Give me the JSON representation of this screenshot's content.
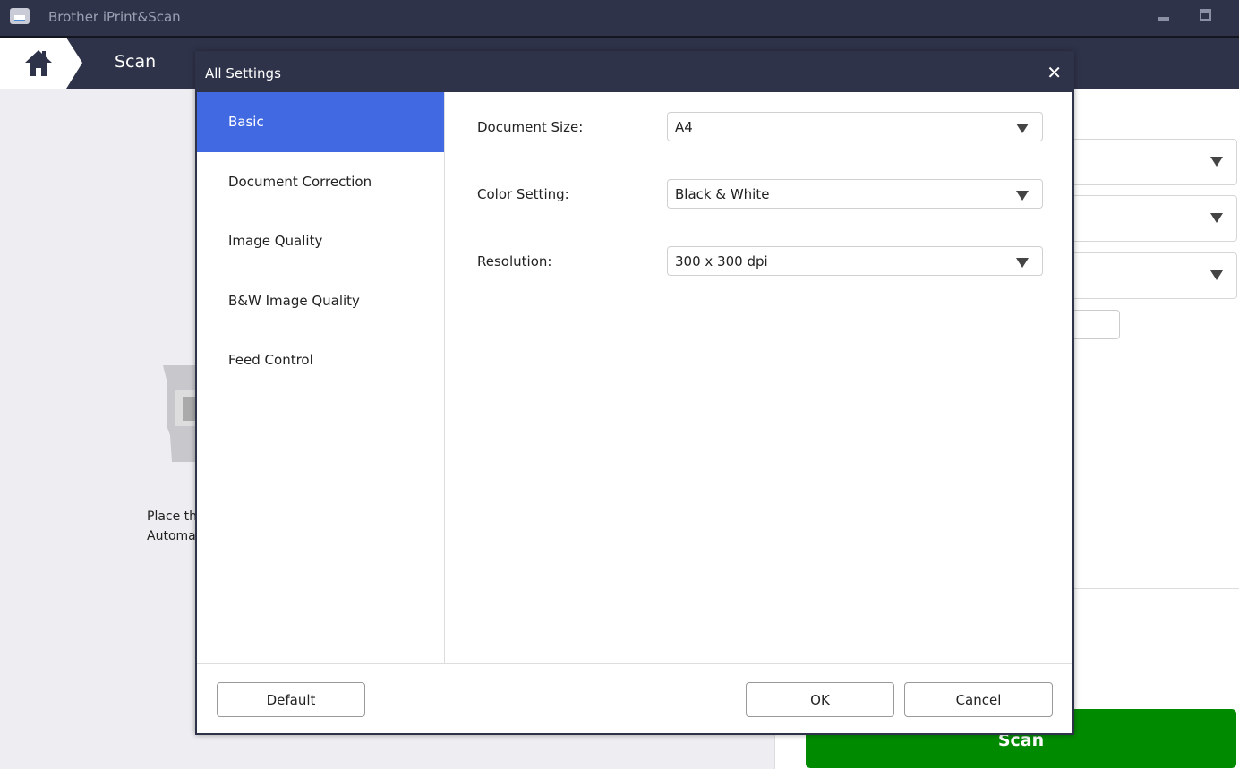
{
  "app": {
    "title": "Brother iPrint&Scan",
    "section": "Scan"
  },
  "background": {
    "instruction_line1": "Place the",
    "instruction_line2": "Automatic",
    "scan_button": "Scan"
  },
  "dialog": {
    "title": "All Settings",
    "nav": [
      {
        "label": "Basic",
        "active": true
      },
      {
        "label": "Document Correction"
      },
      {
        "label": "Image Quality"
      },
      {
        "label": "B&W Image Quality"
      },
      {
        "label": "Feed Control"
      }
    ],
    "fields": [
      {
        "label": "Document Size:",
        "value": "A4"
      },
      {
        "label": "Color Setting:",
        "value": "Black & White"
      },
      {
        "label": "Resolution:",
        "value": "300 x 300 dpi"
      }
    ],
    "buttons": {
      "default": "Default",
      "ok": "OK",
      "cancel": "Cancel"
    }
  },
  "colors": {
    "chrome": "#2f3349",
    "accent": "#4169e1",
    "scan": "#008a00"
  }
}
